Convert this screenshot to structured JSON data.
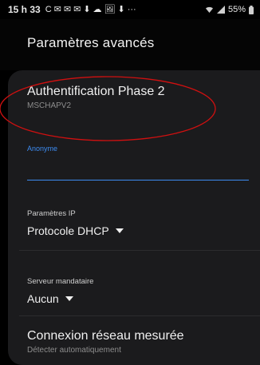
{
  "status_bar": {
    "time": "15 h 33",
    "notification_icons": [
      "C",
      "✉",
      "✉",
      "✉",
      "⬇",
      "☁",
      "🖼",
      "⬇",
      "···"
    ],
    "battery": "55%"
  },
  "header": {
    "title": "Paramètres avancés"
  },
  "settings": {
    "phase2": {
      "title": "Authentification Phase 2",
      "value": "MSCHAPV2"
    },
    "anonymous": {
      "label": "Anonyme",
      "value": ""
    },
    "ip_settings": {
      "label": "Paramètres IP",
      "value": "Protocole DHCP"
    },
    "proxy": {
      "label": "Serveur mandataire",
      "value": "Aucun"
    },
    "metered": {
      "title": "Connexion réseau mesurée",
      "value": "Détecter automatiquement"
    }
  },
  "colors": {
    "background": "#000000",
    "panel": "#1b1b1d",
    "accent": "#3d8bf0",
    "annotation": "#d01010"
  },
  "icons": {
    "dropdown": "caret-down-icon",
    "wifi": "wifi-icon",
    "signal": "signal-icon",
    "battery": "battery-icon"
  }
}
